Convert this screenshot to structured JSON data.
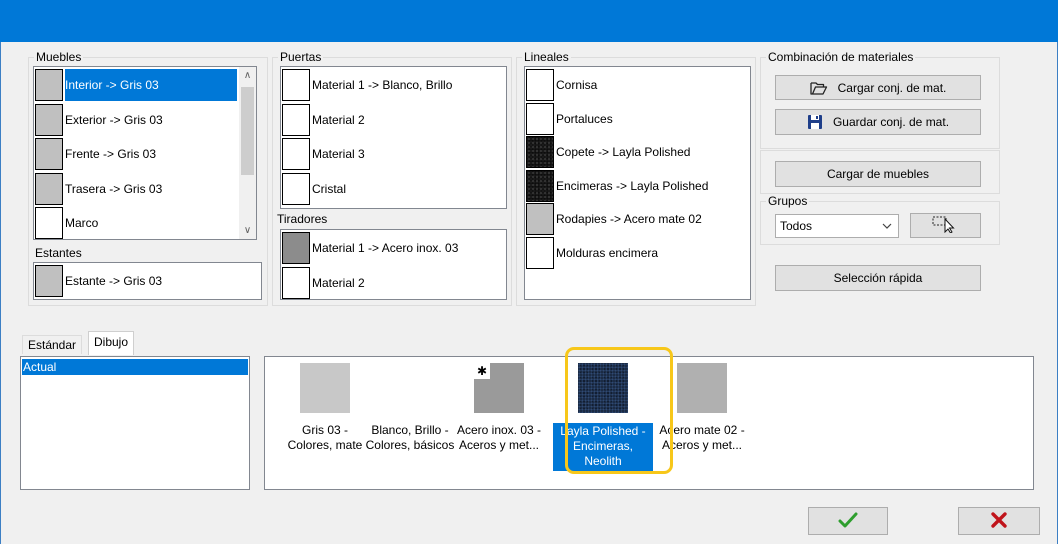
{
  "groups": {
    "muebles": "Muebles",
    "estantes": "Estantes",
    "puertas": "Puertas",
    "tiradores": "Tiradores",
    "lineales": "Lineales",
    "combinacion": "Combinación de materiales",
    "grupos": "Grupos"
  },
  "muebles": [
    {
      "label": "Interior -> Gris 03",
      "swatch": "gray",
      "selected": true
    },
    {
      "label": "Exterior -> Gris 03",
      "swatch": "gray"
    },
    {
      "label": "Frente -> Gris 03",
      "swatch": "gray"
    },
    {
      "label": "Trasera -> Gris 03",
      "swatch": "gray"
    },
    {
      "label": "Marco",
      "swatch": "white"
    }
  ],
  "estantes": [
    {
      "label": "Estante -> Gris 03",
      "swatch": "gray"
    }
  ],
  "puertas": [
    {
      "label": "Material 1 -> Blanco, Brillo",
      "swatch": "white"
    },
    {
      "label": "Material 2",
      "swatch": "white"
    },
    {
      "label": "Material 3",
      "swatch": "white"
    },
    {
      "label": "Cristal",
      "swatch": "white"
    }
  ],
  "tiradores": [
    {
      "label": "Material 1 -> Acero inox. 03",
      "swatch": "darkgray"
    },
    {
      "label": "Material 2",
      "swatch": "white"
    }
  ],
  "lineales": [
    {
      "label": "Cornisa",
      "swatch": "white"
    },
    {
      "label": "Portaluces",
      "swatch": "white"
    },
    {
      "label": "Copete -> Layla Polished",
      "swatch": "dark"
    },
    {
      "label": "Encimeras -> Layla Polished",
      "swatch": "dark"
    },
    {
      "label": "Rodapies -> Acero mate 02",
      "swatch": "gray"
    },
    {
      "label": "Molduras encimera",
      "swatch": "white"
    }
  ],
  "buttons": {
    "cargar_conj": "Cargar conj. de mat.",
    "guardar_conj": "Guardar conj. de mat.",
    "cargar_muebles": "Cargar de muebles",
    "seleccion_rapida": "Selección rápida"
  },
  "grupos_select": {
    "value": "Todos"
  },
  "tabs": [
    {
      "label": "Estándar",
      "active": false
    },
    {
      "label": "Dibujo",
      "active": true
    }
  ],
  "list_left": [
    {
      "label": "Actual",
      "selected": true
    }
  ],
  "materials": [
    {
      "line1": "Gris 03 -",
      "line2": "Colores, mate",
      "line3": "",
      "color": "#c8c8c8",
      "selected": false
    },
    {
      "line1": "Blanco, Brillo -",
      "line2": "Colores, básicos",
      "line3": "",
      "color": "#ffffff",
      "selected": false
    },
    {
      "line1": "Acero inox. 03 -",
      "line2": "Aceros y met...",
      "line3": "",
      "color": "#9a9a9a",
      "selected": false
    },
    {
      "line1": "Layla Polished -",
      "line2": "Encimeras,",
      "line3": "Neolith",
      "color": "#1b2b44",
      "selected": true
    },
    {
      "line1": "Acero mate 02 -",
      "line2": "Aceros y met...",
      "line3": "",
      "color": "#b0b0b0",
      "selected": false
    }
  ],
  "colors": {
    "accent": "#0078d7",
    "highlight": "#f7c71a",
    "ok": "#2e9e2e",
    "cancel": "#c0141b"
  }
}
